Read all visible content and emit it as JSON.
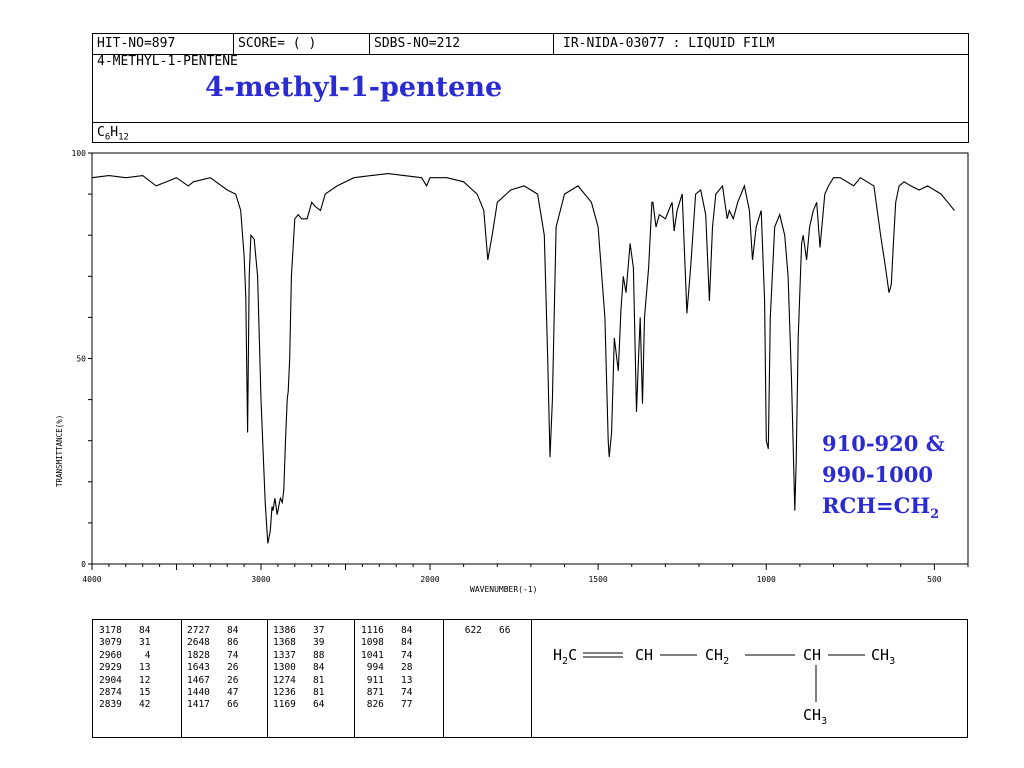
{
  "header": {
    "hit_no": "HIT-NO=897",
    "score": "SCORE=  (   )",
    "sdbs_no": "SDBS-NO=212",
    "ir_info": "IR-NIDA-03077 : LIQUID FILM",
    "compound_name": "4-METHYL-1-PENTENE",
    "title_overlay": "4-methyl-1-pentene",
    "formula": "C6H12"
  },
  "annotation": {
    "line1": "910-920 &",
    "line2": "990-1000",
    "line3": "RCH=CH2"
  },
  "structure": "H2C== CH— CH2 —CH— CH3 / CH3",
  "colors": {
    "accent": "#2b2bd4",
    "line": "#000000"
  },
  "chart_data": {
    "type": "line",
    "xlabel": "WAVENUMBER(-1)",
    "ylabel": "TRANSMITTANCE(%)",
    "xlim": [
      4000,
      400
    ],
    "ylim": [
      0,
      100
    ],
    "xticks": [
      4000,
      3000,
      2000,
      1500,
      1000,
      500
    ],
    "yticks": [
      0,
      50,
      100
    ],
    "x": [
      4000,
      3900,
      3800,
      3700,
      3620,
      3500,
      3430,
      3400,
      3300,
      3200,
      3150,
      3120,
      3100,
      3090,
      3079,
      3070,
      3060,
      3040,
      3020,
      3000,
      2975,
      2960,
      2945,
      2935,
      2929,
      2918,
      2904,
      2895,
      2885,
      2874,
      2865,
      2855,
      2845,
      2839,
      2830,
      2820,
      2800,
      2780,
      2760,
      2727,
      2700,
      2680,
      2648,
      2620,
      2550,
      2450,
      2350,
      2250,
      2050,
      2020,
      2000,
      1950,
      1900,
      1860,
      1840,
      1828,
      1815,
      1800,
      1760,
      1720,
      1680,
      1660,
      1650,
      1643,
      1636,
      1625,
      1600,
      1560,
      1520,
      1500,
      1480,
      1470,
      1467,
      1460,
      1452,
      1440,
      1432,
      1425,
      1417,
      1405,
      1395,
      1386,
      1380,
      1375,
      1368,
      1362,
      1350,
      1340,
      1337,
      1328,
      1318,
      1300,
      1290,
      1280,
      1274,
      1265,
      1250,
      1236,
      1225,
      1210,
      1195,
      1180,
      1169,
      1160,
      1150,
      1130,
      1116,
      1110,
      1098,
      1085,
      1065,
      1050,
      1041,
      1030,
      1015,
      1005,
      1000,
      994,
      988,
      975,
      960,
      945,
      935,
      925,
      915,
      911,
      905,
      895,
      890,
      880,
      871,
      860,
      850,
      840,
      826,
      815,
      800,
      780,
      760,
      740,
      720,
      700,
      680,
      660,
      645,
      635,
      628,
      622,
      615,
      605,
      590,
      570,
      545,
      520,
      500,
      480,
      460,
      440,
      420,
      400
    ],
    "y": [
      94,
      94.5,
      94,
      94.5,
      92,
      94,
      92,
      93,
      94,
      91,
      90,
      86,
      75,
      65,
      32,
      70,
      80,
      79,
      70,
      40,
      15,
      5,
      8,
      14,
      13,
      16,
      12,
      14,
      16,
      15,
      18,
      30,
      40,
      42,
      50,
      70,
      84,
      85,
      84,
      84,
      88,
      87,
      86,
      90,
      92,
      94,
      94.5,
      95,
      94,
      92,
      94,
      94,
      93,
      90,
      86,
      74,
      80,
      88,
      91,
      92,
      90,
      80,
      50,
      26,
      40,
      82,
      90,
      92,
      88,
      82,
      60,
      30,
      26,
      32,
      55,
      47,
      62,
      70,
      66,
      78,
      72,
      37,
      50,
      60,
      39,
      60,
      72,
      88,
      88,
      82,
      85,
      84,
      86,
      88,
      81,
      86,
      90,
      61,
      72,
      90,
      91,
      85,
      64,
      82,
      90,
      92,
      84,
      86,
      84,
      88,
      92,
      86,
      74,
      82,
      86,
      64,
      30,
      28,
      60,
      82,
      85,
      80,
      70,
      45,
      13,
      25,
      55,
      78,
      80,
      74,
      82,
      86,
      88,
      77,
      90,
      92,
      94,
      94,
      93,
      92,
      94,
      93,
      92,
      80,
      72,
      66,
      68,
      78,
      88,
      92,
      93,
      92,
      91,
      92,
      91,
      90,
      88,
      86
    ],
    "peak_table": [
      [
        "3178",
        "84"
      ],
      [
        "3079",
        "31"
      ],
      [
        "2960",
        "4"
      ],
      [
        "2929",
        "13"
      ],
      [
        "2904",
        "12"
      ],
      [
        "2874",
        "15"
      ],
      [
        "2839",
        "42"
      ],
      [
        "2727",
        "84"
      ],
      [
        "2648",
        "86"
      ],
      [
        "1828",
        "74"
      ],
      [
        "1643",
        "26"
      ],
      [
        "1467",
        "26"
      ],
      [
        "1440",
        "47"
      ],
      [
        "1417",
        "66"
      ],
      [
        "1386",
        "37"
      ],
      [
        "1368",
        "39"
      ],
      [
        "1337",
        "88"
      ],
      [
        "1300",
        "84"
      ],
      [
        "1274",
        "81"
      ],
      [
        "1236",
        "81"
      ],
      [
        "1169",
        "64"
      ],
      [
        "1116",
        "84"
      ],
      [
        "1098",
        "84"
      ],
      [
        "1041",
        "74"
      ],
      [
        "994",
        "28"
      ],
      [
        "911",
        "13"
      ],
      [
        "871",
        "74"
      ],
      [
        "826",
        "77"
      ],
      [
        "622",
        "66"
      ]
    ]
  }
}
